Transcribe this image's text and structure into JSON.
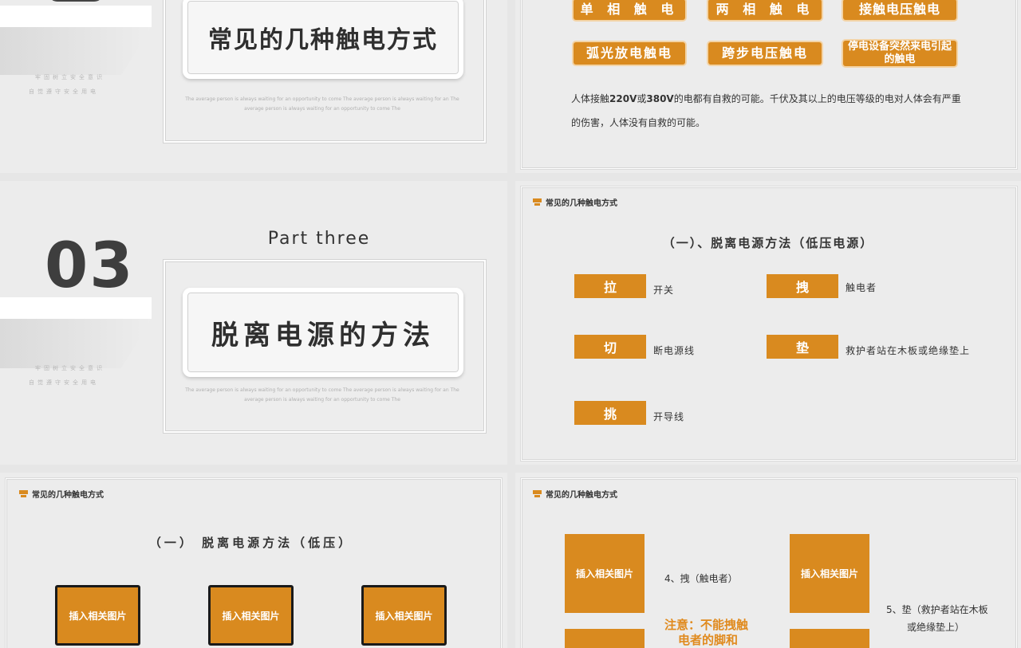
{
  "slide1": {
    "title": "常见的几种触电方式",
    "tiny1": "牢固树立安全意识",
    "tiny2": "自觉遵守安全用电",
    "en_note": "The average person is always waiting for an opportunity to come The average person is always waiting for an The average person is always waiting for an opportunity to come The"
  },
  "slide2": {
    "pills": [
      "单 相 触 电",
      "两 相 触 电",
      "接触电压触电",
      "弧光放电触电",
      "跨步电压触电",
      "停电设备突然来电引起的触电"
    ],
    "para_prefix": "人体接触",
    "para_v1": "220V",
    "para_or": "或",
    "para_v2": "380V",
    "para_rest": "的电都有自救的可能。千伏及其以上的电压等级的电对人体会有严重",
    "para_line2": "的伤害，人体没有自救的可能。"
  },
  "slide3": {
    "number": "03",
    "part": "Part three",
    "title": "脱离电源的方法",
    "tiny1": "牢固树立安全意识",
    "tiny2": "自觉遵守安全用电",
    "en_note": "The average person is always waiting for an opportunity to come The average person is always waiting for an The average person is always waiting for an opportunity to come The"
  },
  "slide4": {
    "header": "常见的几种触电方式",
    "section": "（一）、脱离电源方法（低压电源）",
    "methods": [
      {
        "key": "拉",
        "label": "开关"
      },
      {
        "key": "拽",
        "label": "触电者"
      },
      {
        "key": "切",
        "label": "断电源线"
      },
      {
        "key": "垫",
        "label": "救护者站在木板或绝缘垫上"
      },
      {
        "key": "挑",
        "label": "开导线"
      }
    ]
  },
  "slide5": {
    "header": "常见的几种触电方式",
    "section": "（一） 脱离电源方法（低压）",
    "images": [
      "插入相关图片",
      "插入相关图片",
      "插入相关图片"
    ]
  },
  "slide6": {
    "header": "常见的几种触电方式",
    "images": [
      "插入相关图片",
      "插入相关图片"
    ],
    "caption4": "4、拽（触电者）",
    "caption5_l1": "5、垫（救护者站在木板",
    "caption5_l2": "或绝缘垫上）",
    "note_l1": "注意：不能拽触",
    "note_l2": "电者的脚和"
  },
  "colors": {
    "accent": "#d98a1f",
    "background": "#ececec"
  }
}
